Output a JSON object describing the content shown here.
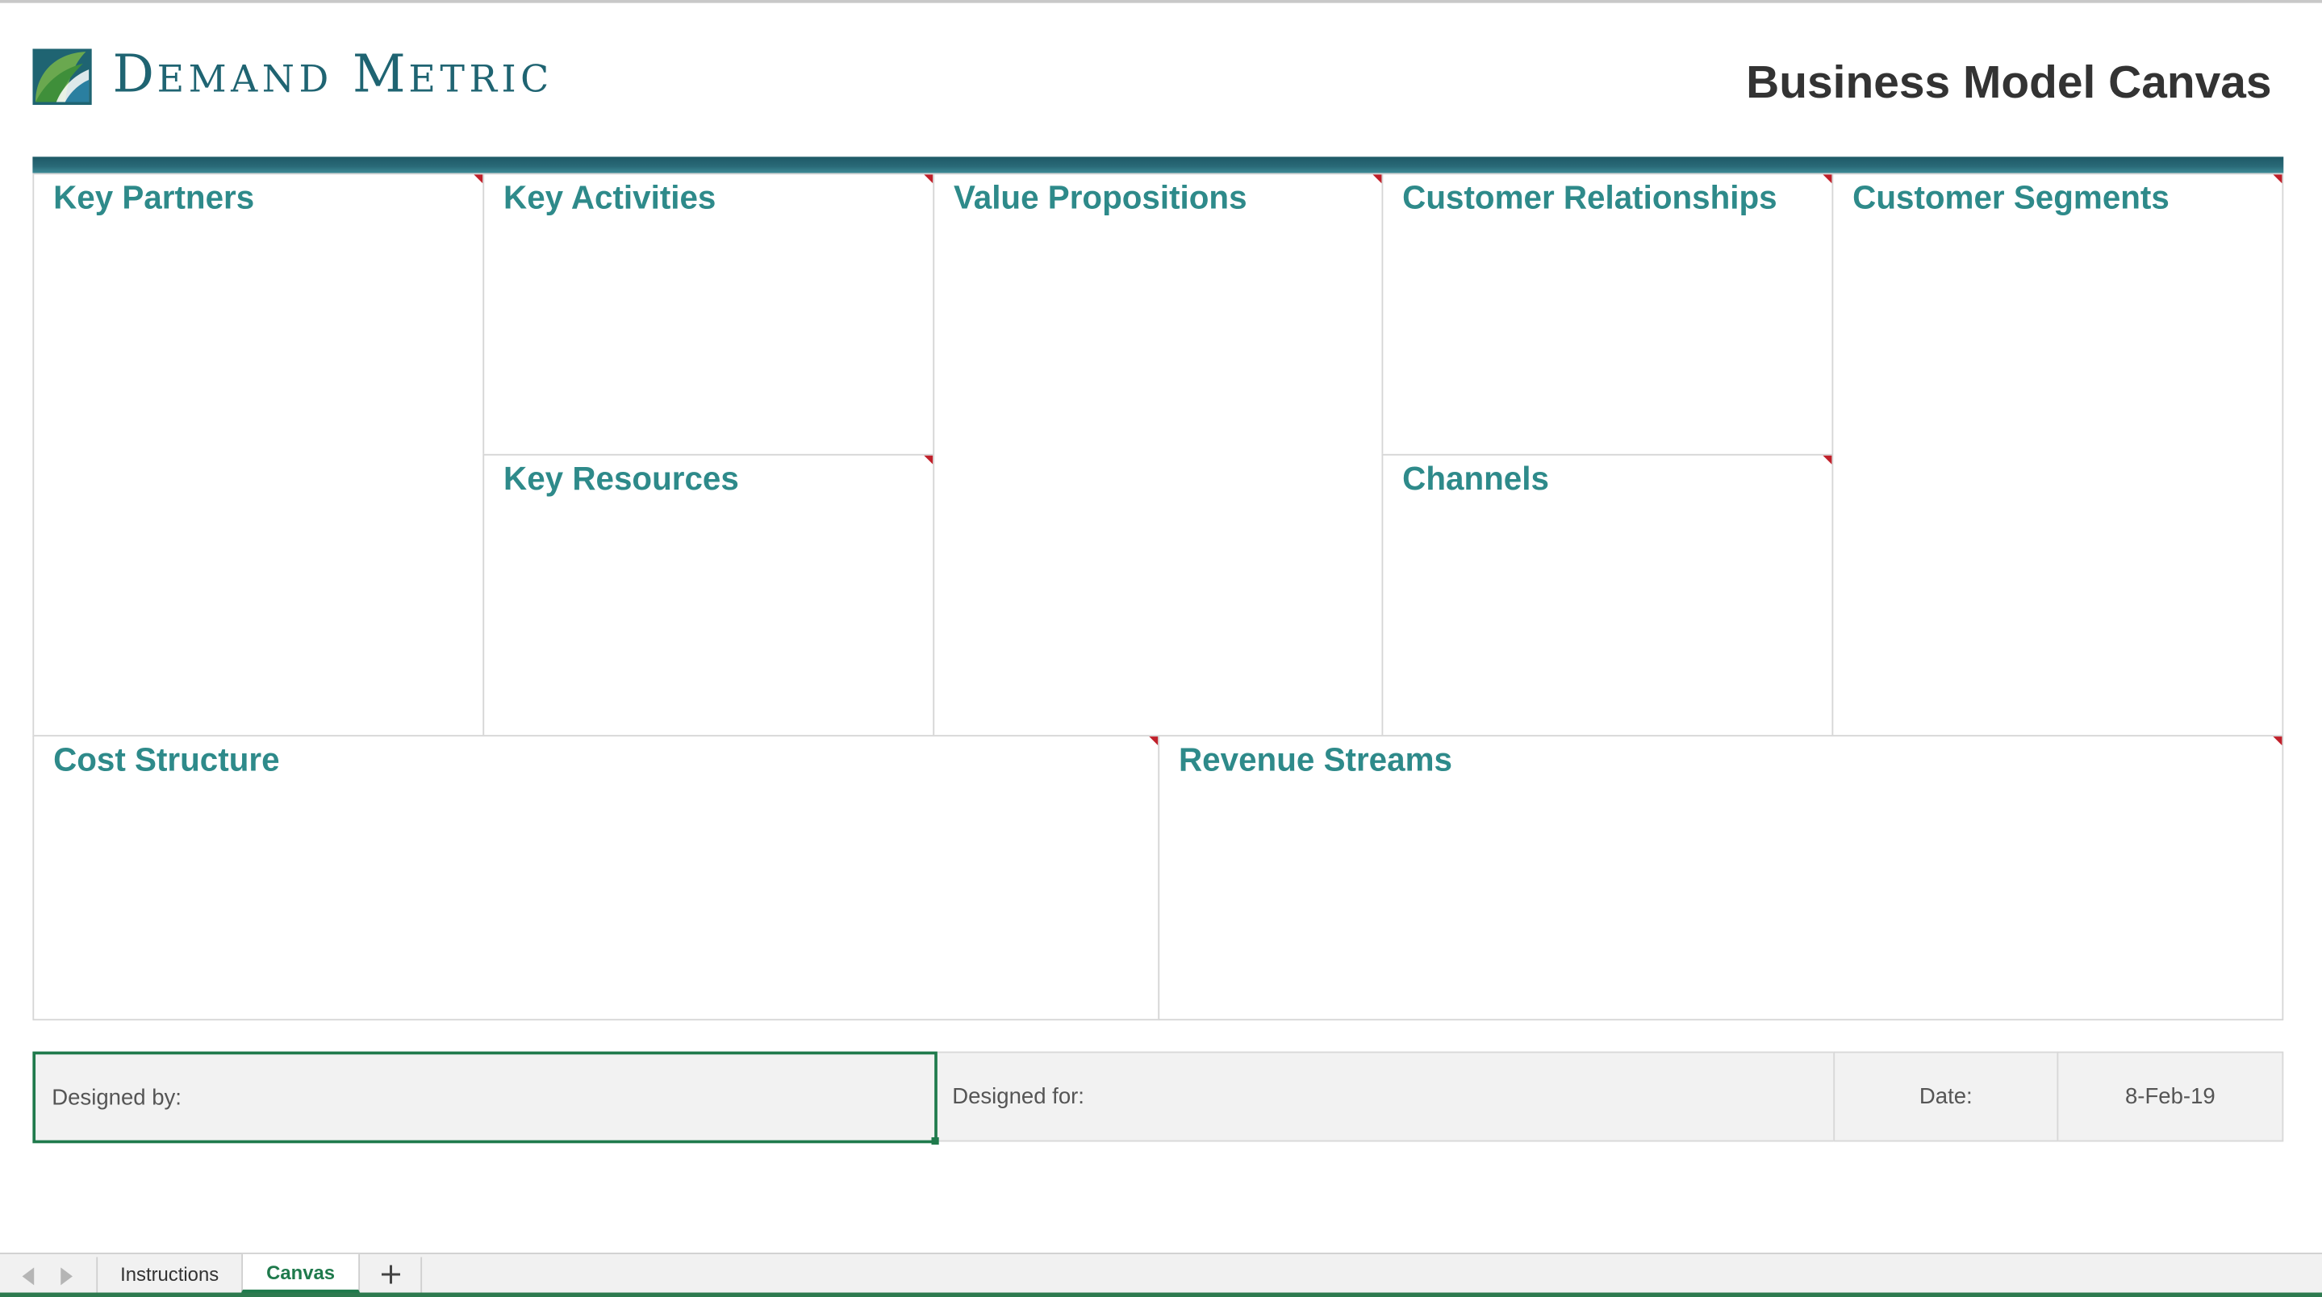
{
  "brand": {
    "name_first_initial": "D",
    "name_first_rest": "EMAND",
    "name_second_initial": "M",
    "name_second_rest": "ETRIC",
    "logo_icon": "demand-metric-leaf-logo",
    "brand_color": "#1f6472"
  },
  "document": {
    "title": "Business Model Canvas"
  },
  "canvas": {
    "accent_color": "#2e8a8a",
    "blocks": {
      "key_partners": "Key Partners",
      "key_activities": "Key Activities",
      "key_resources": "Key Resources",
      "value_propositions": "Value Propositions",
      "customer_relationships": "Customer Relationships",
      "channels": "Channels",
      "customer_segments": "Customer Segments",
      "cost_structure": "Cost Structure",
      "revenue_streams": "Revenue Streams"
    }
  },
  "footer": {
    "designed_by_label": "Designed by:",
    "designed_for_label": "Designed for:",
    "date_label": "Date:",
    "date_value": "8-Feb-19"
  },
  "sheet_tabs": {
    "tabs": [
      "Instructions",
      "Canvas"
    ],
    "active": "Canvas",
    "add_icon": "plus-icon",
    "nav_prev_icon": "triangle-left-icon",
    "nav_next_icon": "triangle-right-icon"
  }
}
